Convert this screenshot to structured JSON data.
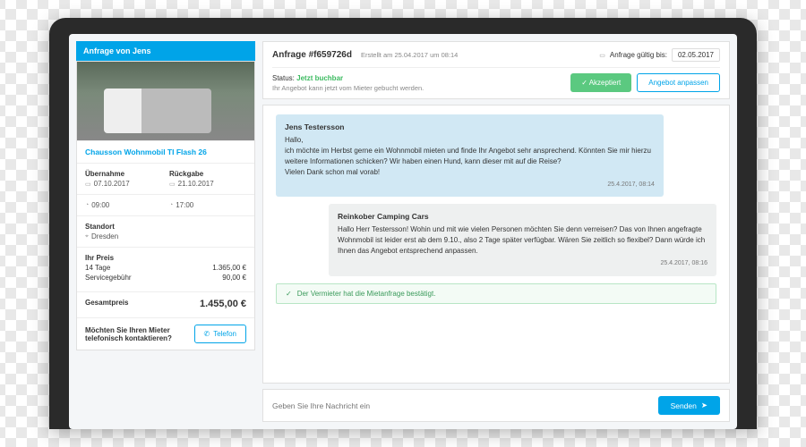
{
  "sidebar": {
    "header": "Anfrage von Jens",
    "vehicle_title": "Chausson Wohnmobil TI Flash 26",
    "pickup_label": "Übernahme",
    "pickup_date": "07.10.2017",
    "pickup_time": "09:00",
    "return_label": "Rückgabe",
    "return_date": "21.10.2017",
    "return_time": "17:00",
    "location_label": "Standort",
    "location": "Dresden",
    "price_label": "Ihr Preis",
    "days_label": "14 Tage",
    "days_price": "1.365,00 €",
    "fee_label": "Servicegebühr",
    "fee_price": "90,00 €",
    "total_label": "Gesamtpreis",
    "total": "1.455,00 €",
    "contact_q": "Möchten Sie Ihren Mieter telefonisch kontaktieren?",
    "phone_btn": "Telefon"
  },
  "header": {
    "request_prefix": "Anfrage ",
    "request_id": "#f659726d",
    "created": "Erstellt am 25.04.2017 um 08:14",
    "valid_label": "Anfrage gültig bis:",
    "valid_date": "02.05.2017",
    "status_prefix": "Status: ",
    "status": "Jetzt buchbar",
    "status_sub": "Ihr Angebot kann jetzt vom Mieter gebucht werden.",
    "accept": "Akzeptiert",
    "adjust": "Angebot anpassen"
  },
  "chat": {
    "m1_name": "Jens Testersson",
    "m1_body": "Hallo,\nich möchte im Herbst gerne ein Wohnmobil mieten und finde Ihr Angebot sehr ansprechend. Könnten Sie mir hierzu weitere Informationen schicken? Wir haben einen Hund, kann dieser mit auf die Reise?\nVielen Dank schon mal vorab!",
    "m1_time": "25.4.2017, 08:14",
    "m2_name": "Reinkober Camping Cars",
    "m2_body": "Hallo Herr Testersson! Wohin und mit wie vielen Personen möchten Sie denn verreisen? Das von Ihnen angefragte Wohnmobil ist leider erst ab dem 9.10., also 2 Tage später verfügbar. Wären Sie zeitlich so flexibel? Dann würde ich Ihnen das Angebot entsprechend anpassen.",
    "m2_time": "25.4.2017, 08:16",
    "confirm": "Der Vermieter hat die Mietanfrage bestätigt."
  },
  "input": {
    "placeholder": "Geben Sie Ihre Nachricht ein",
    "send": "Senden"
  }
}
